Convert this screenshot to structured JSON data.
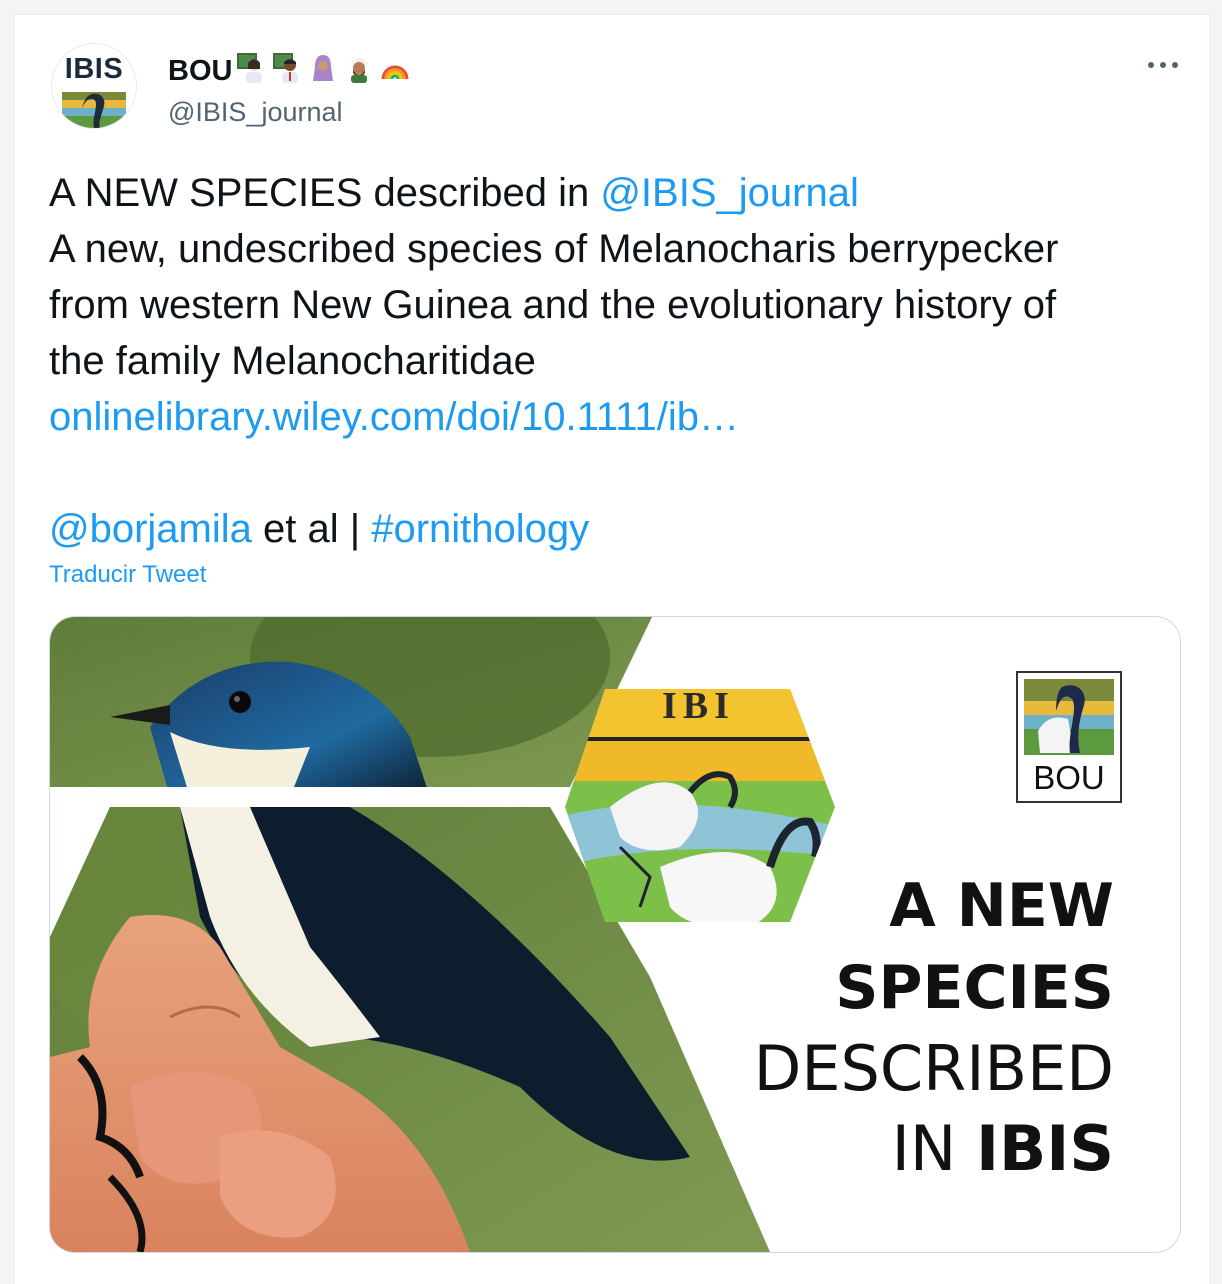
{
  "author": {
    "avatar_text": "IBIS",
    "display_name": "BOU",
    "emojis": [
      "woman-teacher-emoji",
      "man-teacher-emoji",
      "woman-headscarf-emoji",
      "man-turban-emoji",
      "rainbow-emoji"
    ],
    "handle": "@IBIS_journal"
  },
  "tweet": {
    "line1_prefix": "A NEW SPECIES described in ",
    "line1_mention": "@IBIS_journal",
    "line2": "A new, undescribed species of Melanocharis berrypecker",
    "line3": "from western New Guinea and the evolutionary history of",
    "line4": "the family Melanocharitidae",
    "link": "onlinelibrary.wiley.com/doi/10.1111/ib…",
    "mention2": "@borjamila",
    "middle_text": " et al | ",
    "hashtag": "#ornithology",
    "translate": "Traducir Tweet"
  },
  "media": {
    "cover_title": "IBI",
    "logo_label": "BOU",
    "headline_line1": "A NEW",
    "headline_line2": "SPECIES",
    "headline_line3": "DESCRIBED",
    "headline_line4_prefix": "IN ",
    "headline_line4_bold": "IBIS"
  },
  "colors": {
    "link": "#1d9bf0",
    "secondary_text": "#536471",
    "border": "#cfd9de"
  }
}
